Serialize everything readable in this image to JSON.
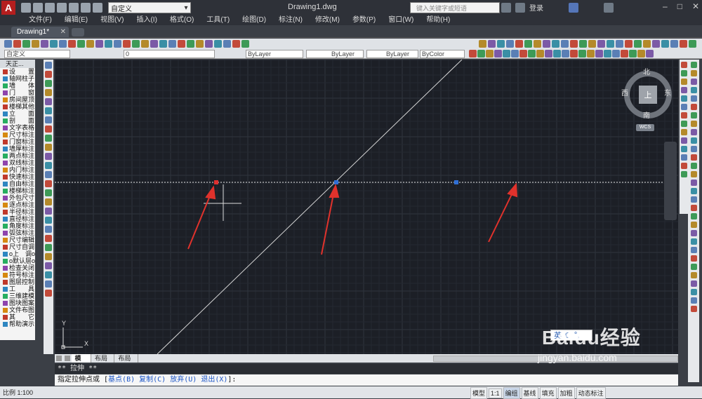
{
  "titlebar": {
    "workspace": "自定义",
    "document_title": "Drawing1.dwg",
    "search_placeholder": "键入关键字或短语",
    "login_label": "登录"
  },
  "menu": [
    "文件(F)",
    "编辑(E)",
    "视图(V)",
    "插入(I)",
    "格式(O)",
    "工具(T)",
    "绘图(D)",
    "标注(N)",
    "修改(M)",
    "参数(P)",
    "窗口(W)",
    "帮助(H)"
  ],
  "tabs": {
    "doc_tab": "Drawing1*"
  },
  "toolbar2": {
    "layer_state": "自定义",
    "layer_name": "0",
    "color": "ByLayer",
    "linetype": "ByLayer",
    "lineweight": "ByLayer",
    "plotstyle": "ByColor"
  },
  "palette": {
    "title": "天正...",
    "items": [
      "设　　置",
      "轴网柱子",
      "墙　　体",
      "门　　窗",
      "房间屋顶",
      "楼梯其他",
      "立　　面",
      "剖　　面",
      "文字表格",
      "尺寸标注",
      "门窗标注",
      "墙厚标注",
      "两点标注",
      "双线标注",
      "内门标注",
      "快速标注",
      "自由标注",
      "楼梯标注",
      "外包尺寸",
      "逐点标注",
      "半径标注",
      "直径标注",
      "角度标注",
      "弧弦标注",
      "尺寸编辑",
      "尺寸自调",
      "o上　调o",
      "o默认层o",
      "检查关闭",
      "符号标注",
      "图层控制",
      "工　　具",
      "三维建模",
      "图块图案",
      "文件布图",
      "其　　它",
      "帮助演示"
    ]
  },
  "viewcube": {
    "north": "北",
    "south": "南",
    "east": "东",
    "west": "西",
    "face": "上",
    "wcs": "WCS"
  },
  "ucs": {
    "x": "X",
    "y": "Y"
  },
  "ime": {
    "lang": "英"
  },
  "layout_tabs": [
    "模型",
    "布局1",
    "布局2"
  ],
  "command": {
    "history": "**  拉伸  **",
    "prompt": "指定拉伸点或 [",
    "opt1": "基点(B)",
    "opt2": "复制(C)",
    "opt3": "放弃(U)",
    "opt4": "退出(X)",
    "end": "]:"
  },
  "status": {
    "scale": "比例 1:100",
    "buttons": [
      "模型",
      "1:1",
      "编组",
      "基线",
      "填充",
      "加粗",
      "动态标注"
    ]
  },
  "watermark": {
    "logo": "Baidu经验",
    "url": "jingyan.baidu.com"
  }
}
